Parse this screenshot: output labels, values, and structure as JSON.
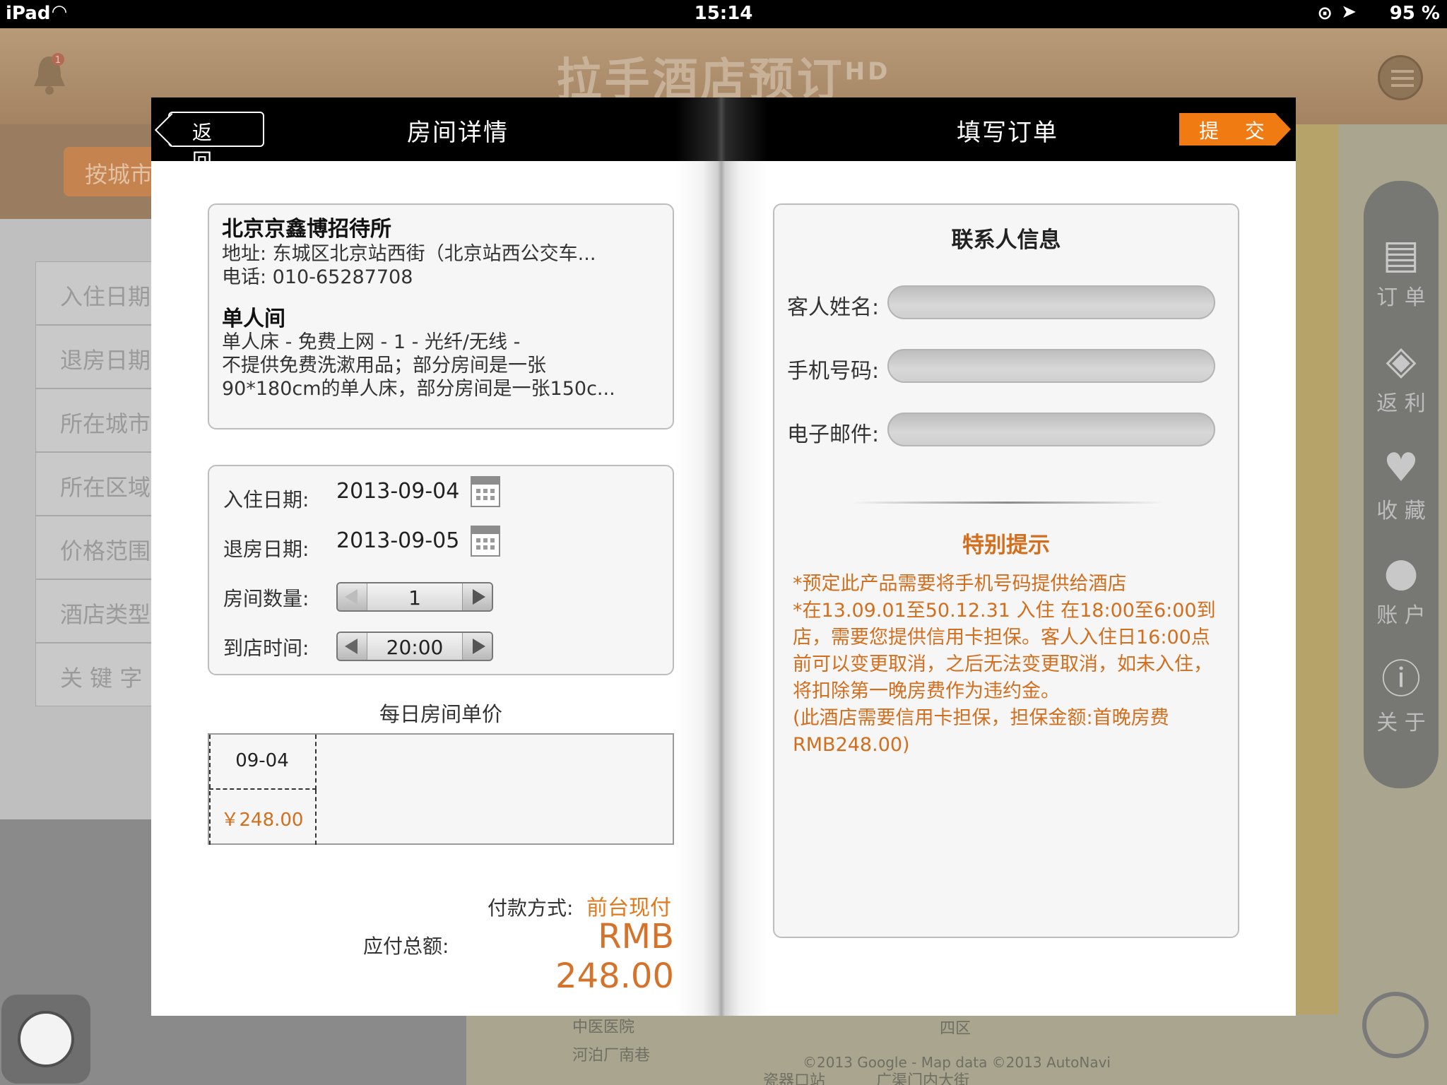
{
  "status": {
    "device": "iPad",
    "time": "15:14",
    "battery": "95 %"
  },
  "background": {
    "app_title": "拉手酒店预订",
    "app_title_suffix": "HD",
    "notification_count": "1",
    "city_button": "按城市",
    "left_list": [
      "入住日期",
      "退房日期",
      "所在城市",
      "所在区域",
      "价格范围",
      "酒店类型",
      "关 键 字"
    ],
    "side_nav": [
      {
        "label": "订 单",
        "icon": "order-icon"
      },
      {
        "label": "返 利",
        "icon": "rebate-tag-icon"
      },
      {
        "label": "收 藏",
        "icon": "heart-icon"
      },
      {
        "label": "账 户",
        "icon": "user-icon"
      },
      {
        "label": "关 于",
        "icon": "info-icon"
      }
    ],
    "map_attribution": "©2013 Google - Map data ©2013 AutoNavi",
    "map_labels": [
      "中医医院",
      "四区",
      "河泊厂南巷",
      "瓷器口站",
      "广渠门内大街"
    ]
  },
  "header": {
    "back_label": "返 回",
    "left_title": "房间详情",
    "right_title": "填写订单",
    "submit_label": "提 交"
  },
  "hotel": {
    "name": "北京京鑫博招待所",
    "address": "地址: 东城区北京站西街（北京站西公交车...",
    "phone": "电话: 010-65287708",
    "room_name": "单人间",
    "room_desc_1": "单人床 - 免费上网 - 1 - 光纤/无线 -",
    "room_desc_2": "不提供免费洗漱用品；部分房间是一张",
    "room_desc_3": "90*180cm的单人床，部分房间是一张150c..."
  },
  "booking": {
    "checkin_label": "入住日期:",
    "checkin_value": "2013-09-04",
    "checkout_label": "退房日期:",
    "checkout_value": "2013-09-05",
    "rooms_label": "房间数量:",
    "rooms_value": "1",
    "arrival_label": "到店时间:",
    "arrival_value": "20:00"
  },
  "daily_price": {
    "title": "每日房间单价",
    "date": "09-04",
    "price": "￥248.00"
  },
  "payment": {
    "method_label": "付款方式:",
    "method_value": "前台现付",
    "total_label": "应付总额:",
    "total_value": "RMB 248.00"
  },
  "contact": {
    "title": "联系人信息",
    "name_label": "客人姓名:",
    "name_value": "",
    "phone_label": "手机号码:",
    "phone_value": "",
    "email_label": "电子邮件:",
    "email_value": ""
  },
  "tips": {
    "title": "特别提示",
    "line1": "*预定此产品需要将手机号码提供给酒店",
    "line2": "*在13.09.01至50.12.31 入住 在18:00至6:00到店，需要您提供信用卡担保。客人入住日16:00点前可以变更取消，之后无法变更取消，如未入住，将扣除第一晚房费作为违约金。",
    "line3": "(此酒店需要信用卡担保，担保金额:首晚房费RMB248.00)"
  },
  "colors": {
    "accent": "#f07b13",
    "warning_text": "#d26f1e",
    "header_bg": "#000000"
  }
}
